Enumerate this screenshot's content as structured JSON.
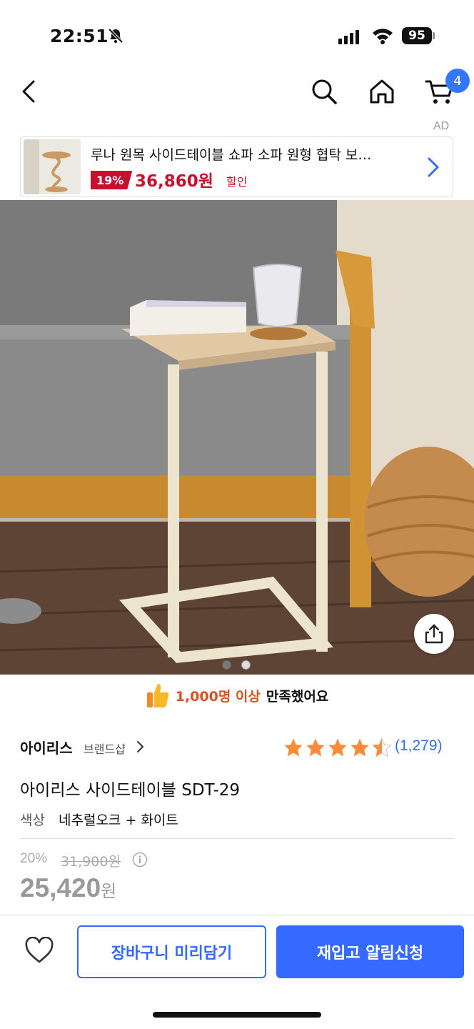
{
  "status_bar": {
    "time": "22:51",
    "battery": "95"
  },
  "nav": {
    "cart_count": "4",
    "ad_label": "AD"
  },
  "ad_banner": {
    "title": "루나 원목 사이드테이블 쇼파 소파 원형 협탁 보…",
    "discount": "19%",
    "price": "36,860원",
    "sale_label": "할인"
  },
  "satisfaction": {
    "highlight": "1,000명 이상",
    "suffix": "만족했어요"
  },
  "product": {
    "brand": "아이리스",
    "brand_shop": "브랜드샵",
    "rating": 4.5,
    "review_count": "(1,279)",
    "title": "아이리스 사이드테이블 SDT-29",
    "option_label": "색상",
    "option_value": "네추럴오크 + 화이트",
    "discount_rate": "20%",
    "original_price": "31,900원",
    "sale_price": "25,420",
    "sale_unit": "원"
  },
  "actions": {
    "add_to_cart": "장바구니 미리담기",
    "restock_alert": "재입고 알림신청"
  },
  "colors": {
    "accent": "#346aff",
    "ad_red": "#c8102e",
    "star": "#f88c3a"
  },
  "icons": [
    "bell-off-icon",
    "signal-icon",
    "wifi-icon",
    "back-icon",
    "search-icon",
    "home-icon",
    "cart-icon",
    "chevron-right-icon",
    "share-icon",
    "thumbs-up-icon",
    "star-icon",
    "info-icon",
    "heart-icon"
  ]
}
